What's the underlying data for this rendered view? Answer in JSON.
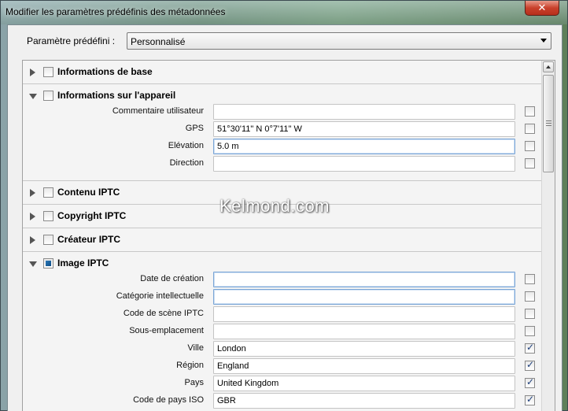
{
  "window": {
    "title": "Modifier les paramètres prédéfinis des métadonnées",
    "close_glyph": "✕"
  },
  "preset": {
    "label": "Paramètre prédéfini :",
    "value": "Personnalisé"
  },
  "sections": [
    {
      "title": "Informations de base",
      "expanded": false,
      "checkbox": "unchecked"
    },
    {
      "title": "Informations sur l'appareil",
      "expanded": true,
      "checkbox": "unchecked",
      "fields": [
        {
          "label": "Commentaire utilisateur",
          "value": "",
          "checked": false
        },
        {
          "label": "GPS",
          "value": "51°30'11\" N 0°7'11\" W",
          "checked": false
        },
        {
          "label": "Elévation",
          "value": "5.0 m",
          "checked": false
        },
        {
          "label": "Direction",
          "value": "",
          "checked": false
        }
      ]
    },
    {
      "title": "Contenu IPTC",
      "expanded": false,
      "checkbox": "unchecked"
    },
    {
      "title": "Copyright IPTC",
      "expanded": false,
      "checkbox": "unchecked"
    },
    {
      "title": "Créateur IPTC",
      "expanded": false,
      "checkbox": "unchecked"
    },
    {
      "title": "Image IPTC",
      "expanded": true,
      "checkbox": "mixed",
      "fields": [
        {
          "label": "Date de création",
          "value": "",
          "checked": false
        },
        {
          "label": "Catégorie intellectuelle",
          "value": "",
          "checked": false
        },
        {
          "label": "Code de scène IPTC",
          "value": "",
          "checked": false
        },
        {
          "label": "Sous-emplacement",
          "value": "",
          "checked": false
        },
        {
          "label": "Ville",
          "value": "London",
          "checked": true
        },
        {
          "label": "Région",
          "value": "England",
          "checked": true
        },
        {
          "label": "Pays",
          "value": "United Kingdom",
          "checked": true
        },
        {
          "label": "Code de pays ISO",
          "value": "GBR",
          "checked": true
        }
      ]
    }
  ],
  "watermark": "Kelmond.com"
}
